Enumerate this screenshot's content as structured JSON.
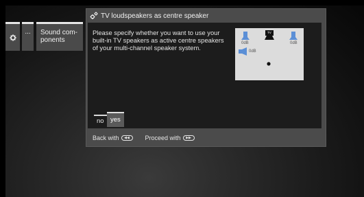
{
  "breadcrumb": {
    "settings_icon": "gear-icon",
    "more_label": "...",
    "sound_components_label": "Sound com-\nponents"
  },
  "dialog": {
    "title_icon": "settings-gears-icon",
    "title": "TV loudspeakers as centre speaker",
    "text": "Please specify whether you want to use your built-in TV speakers as active centre speakers of your multi-channel speaker system.",
    "diagram": {
      "front_left_level": "0dB",
      "front_right_level": "0dB",
      "centre_level": "0dB",
      "tv_label": "TV"
    },
    "options": [
      {
        "label": "no",
        "selected": false
      },
      {
        "label": "yes",
        "selected": true
      }
    ],
    "footer": {
      "back_label": "Back with",
      "back_key_icon": "rewind-key-icon",
      "proceed_label": "Proceed with",
      "proceed_key_icon": "fast-forward-key-icon"
    }
  },
  "colors": {
    "dialog_frame": "#4b4b4b",
    "dialog_body": "#1c1c1c",
    "speaker_blue": "#5b8fd6",
    "diagram_bg": "#dcdcdc"
  }
}
